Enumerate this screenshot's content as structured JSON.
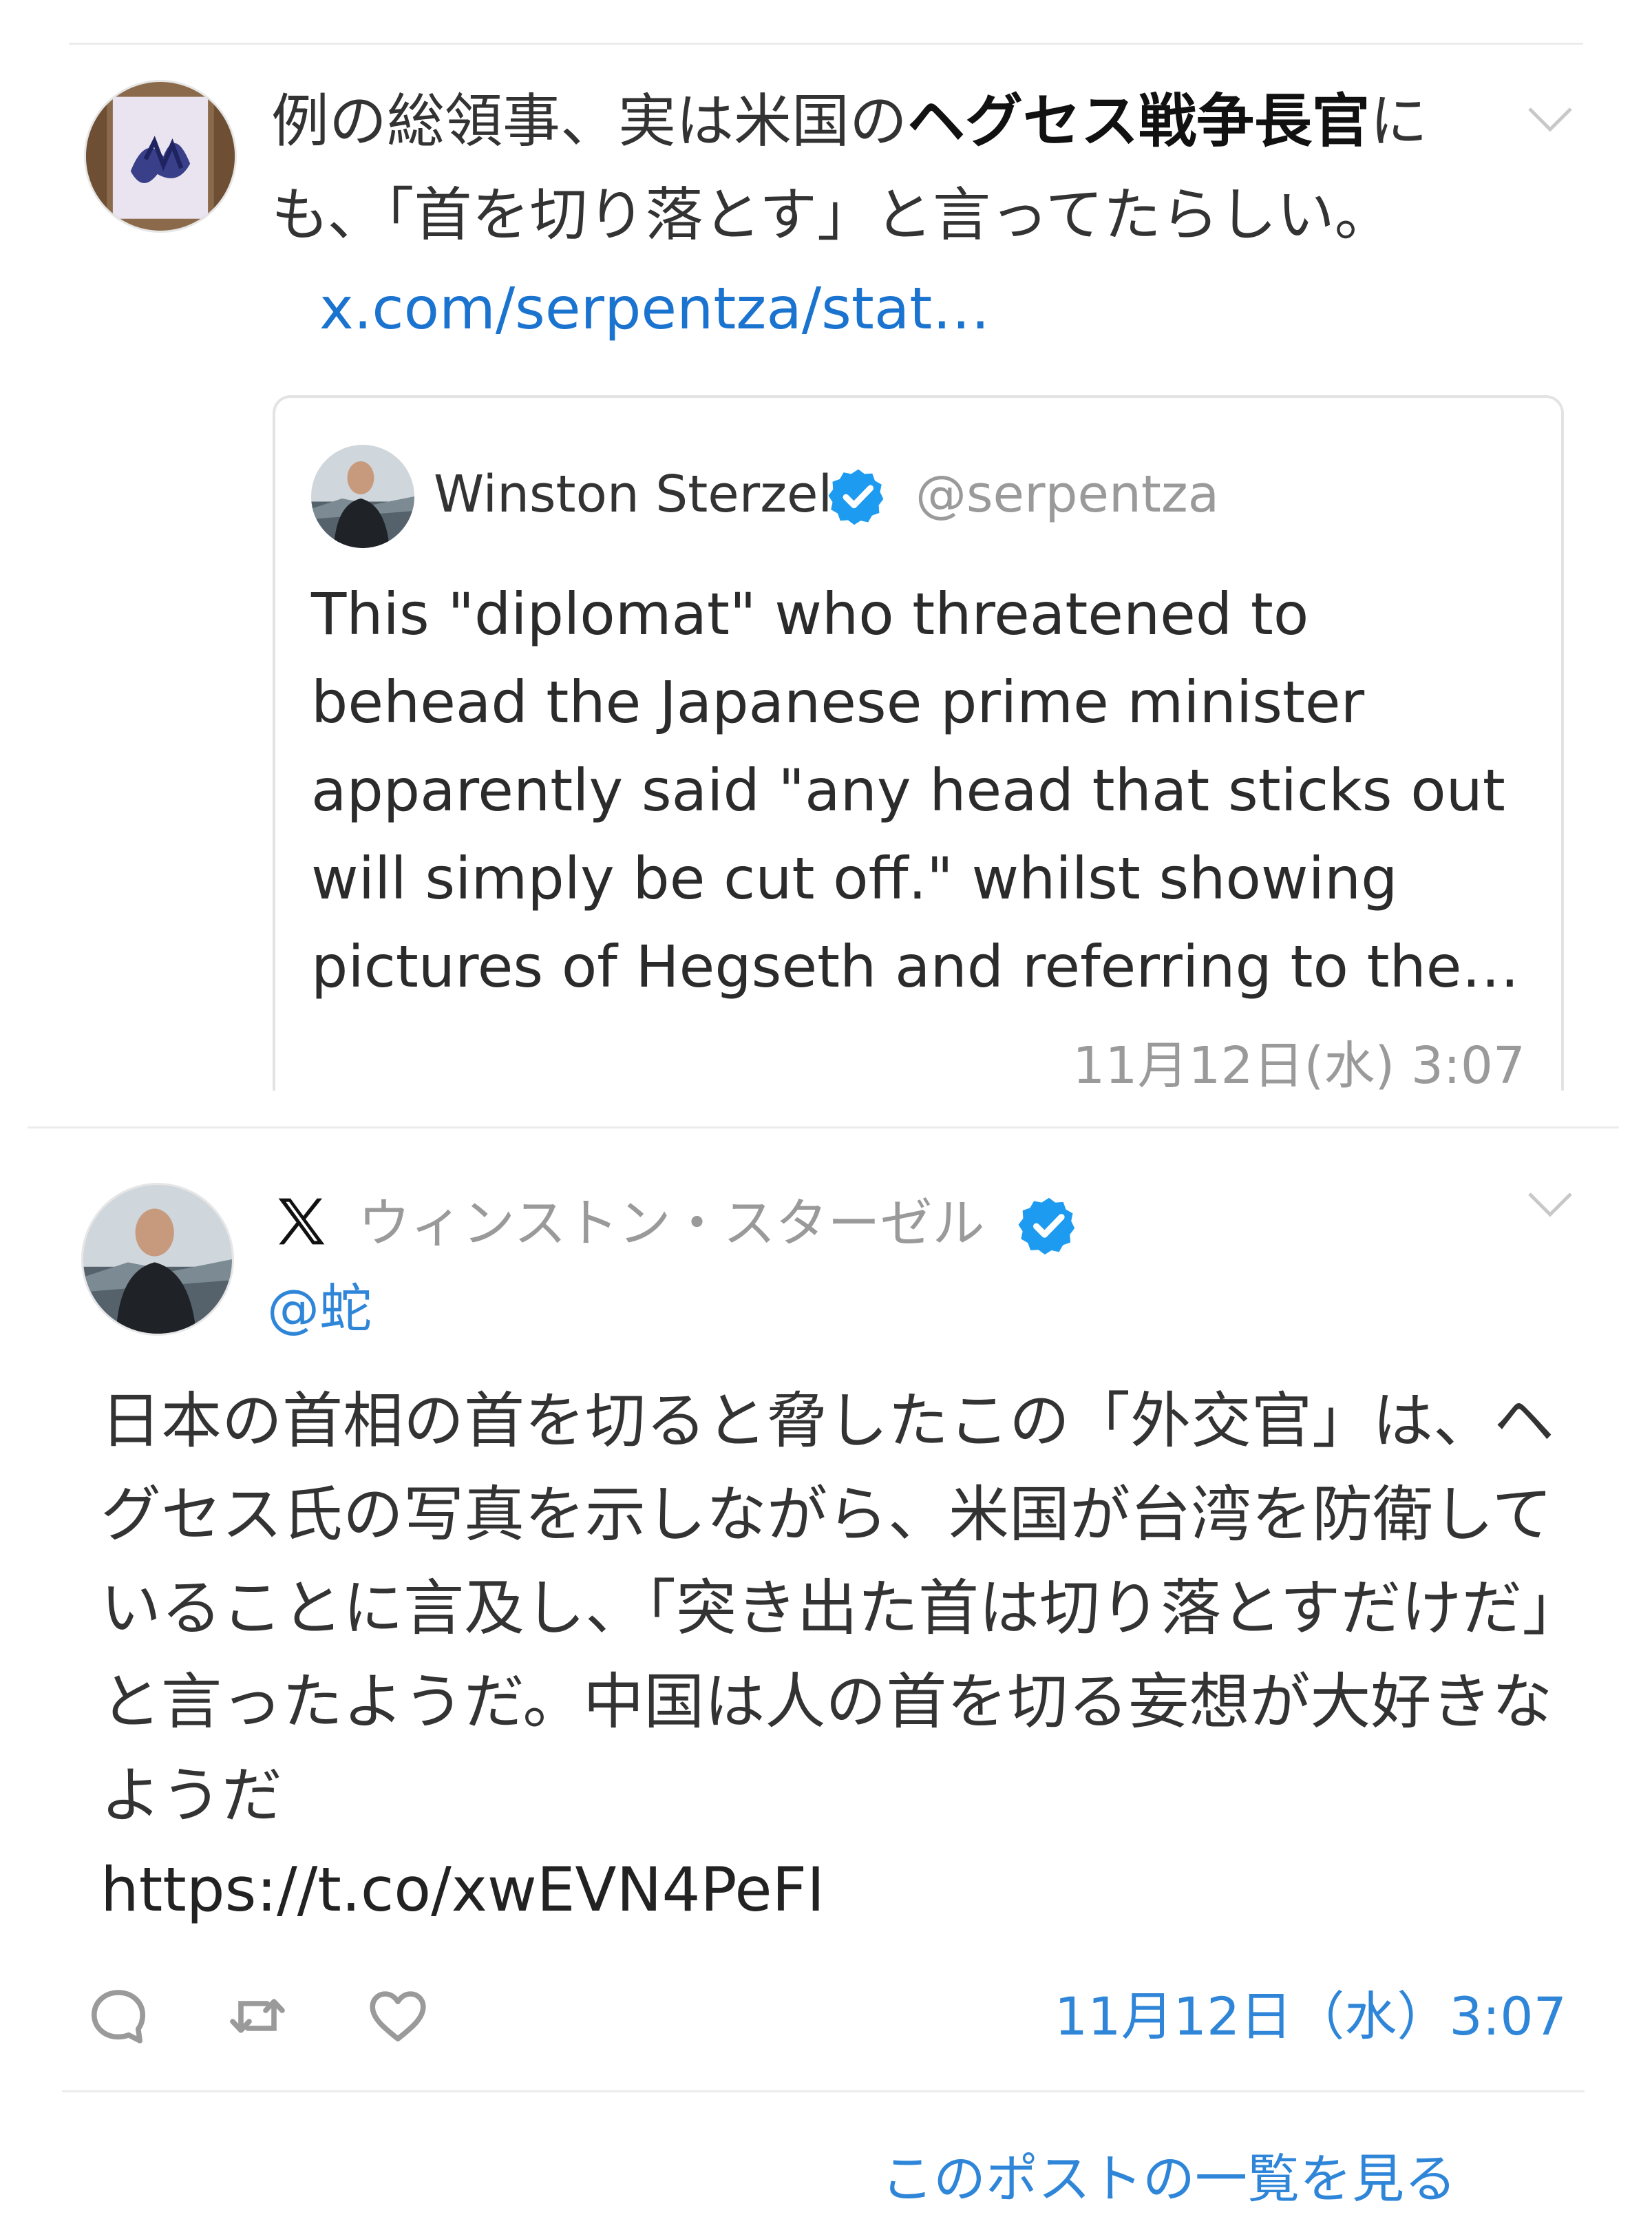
{
  "tweet1": {
    "text_part1": "例の総領事、実は米国の",
    "text_bold": "ヘグセス戦争長官",
    "text_part2": "にも、「首を切り落とす」と言ってたらしい。",
    "link": "x.com/serpentza/stat…",
    "quote": {
      "author_name": "Winston Sterzel",
      "author_handle": "@serpentza",
      "text": "This \"diplomat\" who threatened to behead the Japanese prime minister apparently said \"any head that sticks out will simply be cut off.\" whilst showing pictures of Hegseth and referring to the…",
      "date": "11月12日(水) 3:07"
    }
  },
  "tweet2": {
    "author_name": "ウィンストン・スターゼル",
    "author_handle": "@蛇",
    "text": "日本の首相の首を切ると脅したこの「外交官」は、ヘグセス氏の写真を示しながら、米国が台湾を防衛していることに言及し、「突き出た首は切り落とすだけだ」と言ったようだ。中国は人の首を切る妄想が大好きなようだ",
    "url": "https://t.co/xwEVN4PeFI",
    "date": "11月12日（水）3:07"
  },
  "footer": {
    "more_link": "このポストの一覧を見る"
  },
  "colors": {
    "link_blue": "#1b73d0",
    "accent_blue": "#2f86d8",
    "verified_blue": "#1d9bf0",
    "muted_gray": "#9a9a9a",
    "divider": "#ececec"
  },
  "icons": {
    "menu_chevron": "chevron-down-icon",
    "verified": "verified-badge-icon",
    "x_logo": "x-logo-icon",
    "reply": "reply-icon",
    "retweet": "retweet-icon",
    "like": "heart-icon"
  }
}
